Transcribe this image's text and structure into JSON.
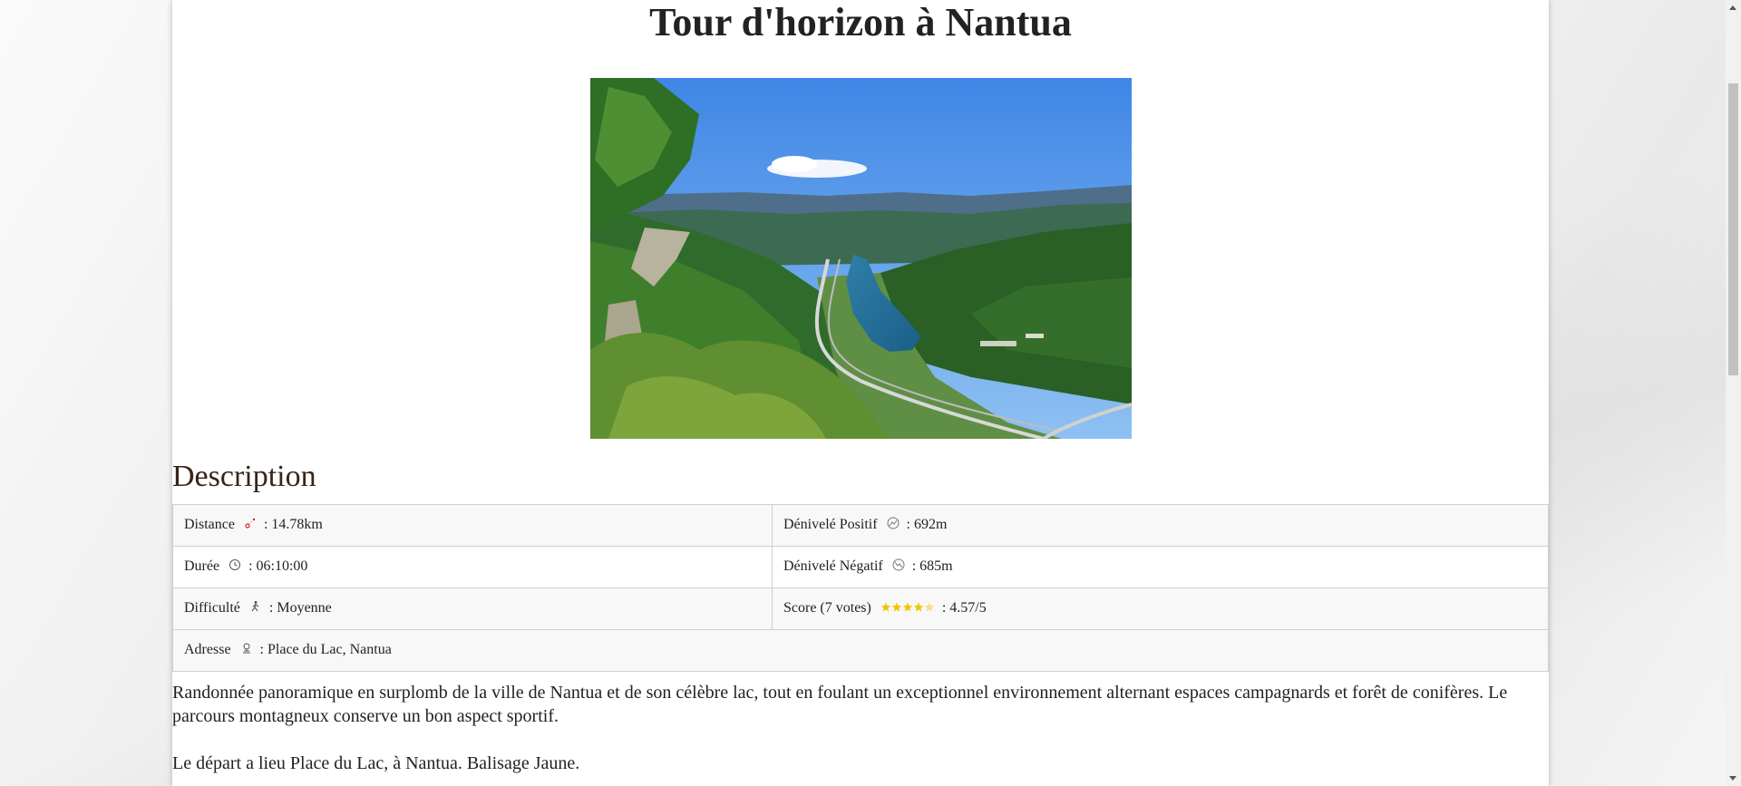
{
  "page": {
    "title": "Tour d'horizon à Nantua",
    "hero_alt": "Vue sur le lac de Nantua"
  },
  "description": {
    "heading": "Description",
    "rows": [
      {
        "left": {
          "label": "Distance",
          "icon": "distance-icon",
          "value": ": 14.78km"
        },
        "right": {
          "label": "Dénivelé Positif",
          "icon": "elevation-up-icon",
          "value": ": 692m"
        }
      },
      {
        "left": {
          "label": "Durée",
          "icon": "clock-icon",
          "value": ": 06:10:00"
        },
        "right": {
          "label": "Dénivelé Négatif",
          "icon": "elevation-down-icon",
          "value": ": 685m"
        }
      },
      {
        "left": {
          "label": "Difficulté",
          "icon": "hiker-icon",
          "value": ": Moyenne"
        },
        "right": {
          "label": "Score (7 votes)",
          "icon": "stars-icon",
          "value": ": 4.57/5",
          "rating": 4.57
        }
      },
      {
        "full": {
          "label": "Adresse",
          "icon": "location-icon",
          "value": ": Place du Lac, Nantua"
        }
      }
    ],
    "paragraphs": [
      "Randonnée panoramique en surplomb de la ville de Nantua et de son célèbre lac, tout en foulant un exceptionnel environnement alternant espaces campagnards et forêt de conifères. Le parcours montagneux conserve un bon aspect sportif.",
      "Le départ a lieu Place du Lac, à Nantua. Balisage Jaune."
    ]
  },
  "colors": {
    "heading": "#222222",
    "section_heading": "#3a2416",
    "star": "#f2c500",
    "border": "#cfcfcf"
  }
}
